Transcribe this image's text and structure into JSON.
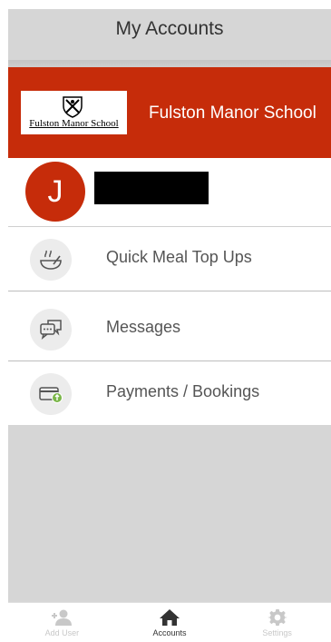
{
  "header": {
    "title": "My Accounts"
  },
  "school": {
    "logo_text": "Fulston Manor School",
    "name": "Fulston Manor School"
  },
  "user": {
    "initial": "J",
    "name": ""
  },
  "menu": [
    {
      "label": "Quick Meal Top Ups",
      "icon": "meal-bowl-icon"
    },
    {
      "label": "Messages",
      "icon": "chat-bubbles-icon"
    },
    {
      "label": "Payments / Bookings",
      "icon": "payment-card-icon"
    }
  ],
  "tabs": [
    {
      "label": "Add User",
      "icon": "add-user-icon",
      "active": false
    },
    {
      "label": "Accounts",
      "icon": "home-icon",
      "active": true
    },
    {
      "label": "Settings",
      "icon": "gear-icon",
      "active": false
    }
  ],
  "colors": {
    "brand": "#c62c0a",
    "gray": "#d6d6d6"
  }
}
